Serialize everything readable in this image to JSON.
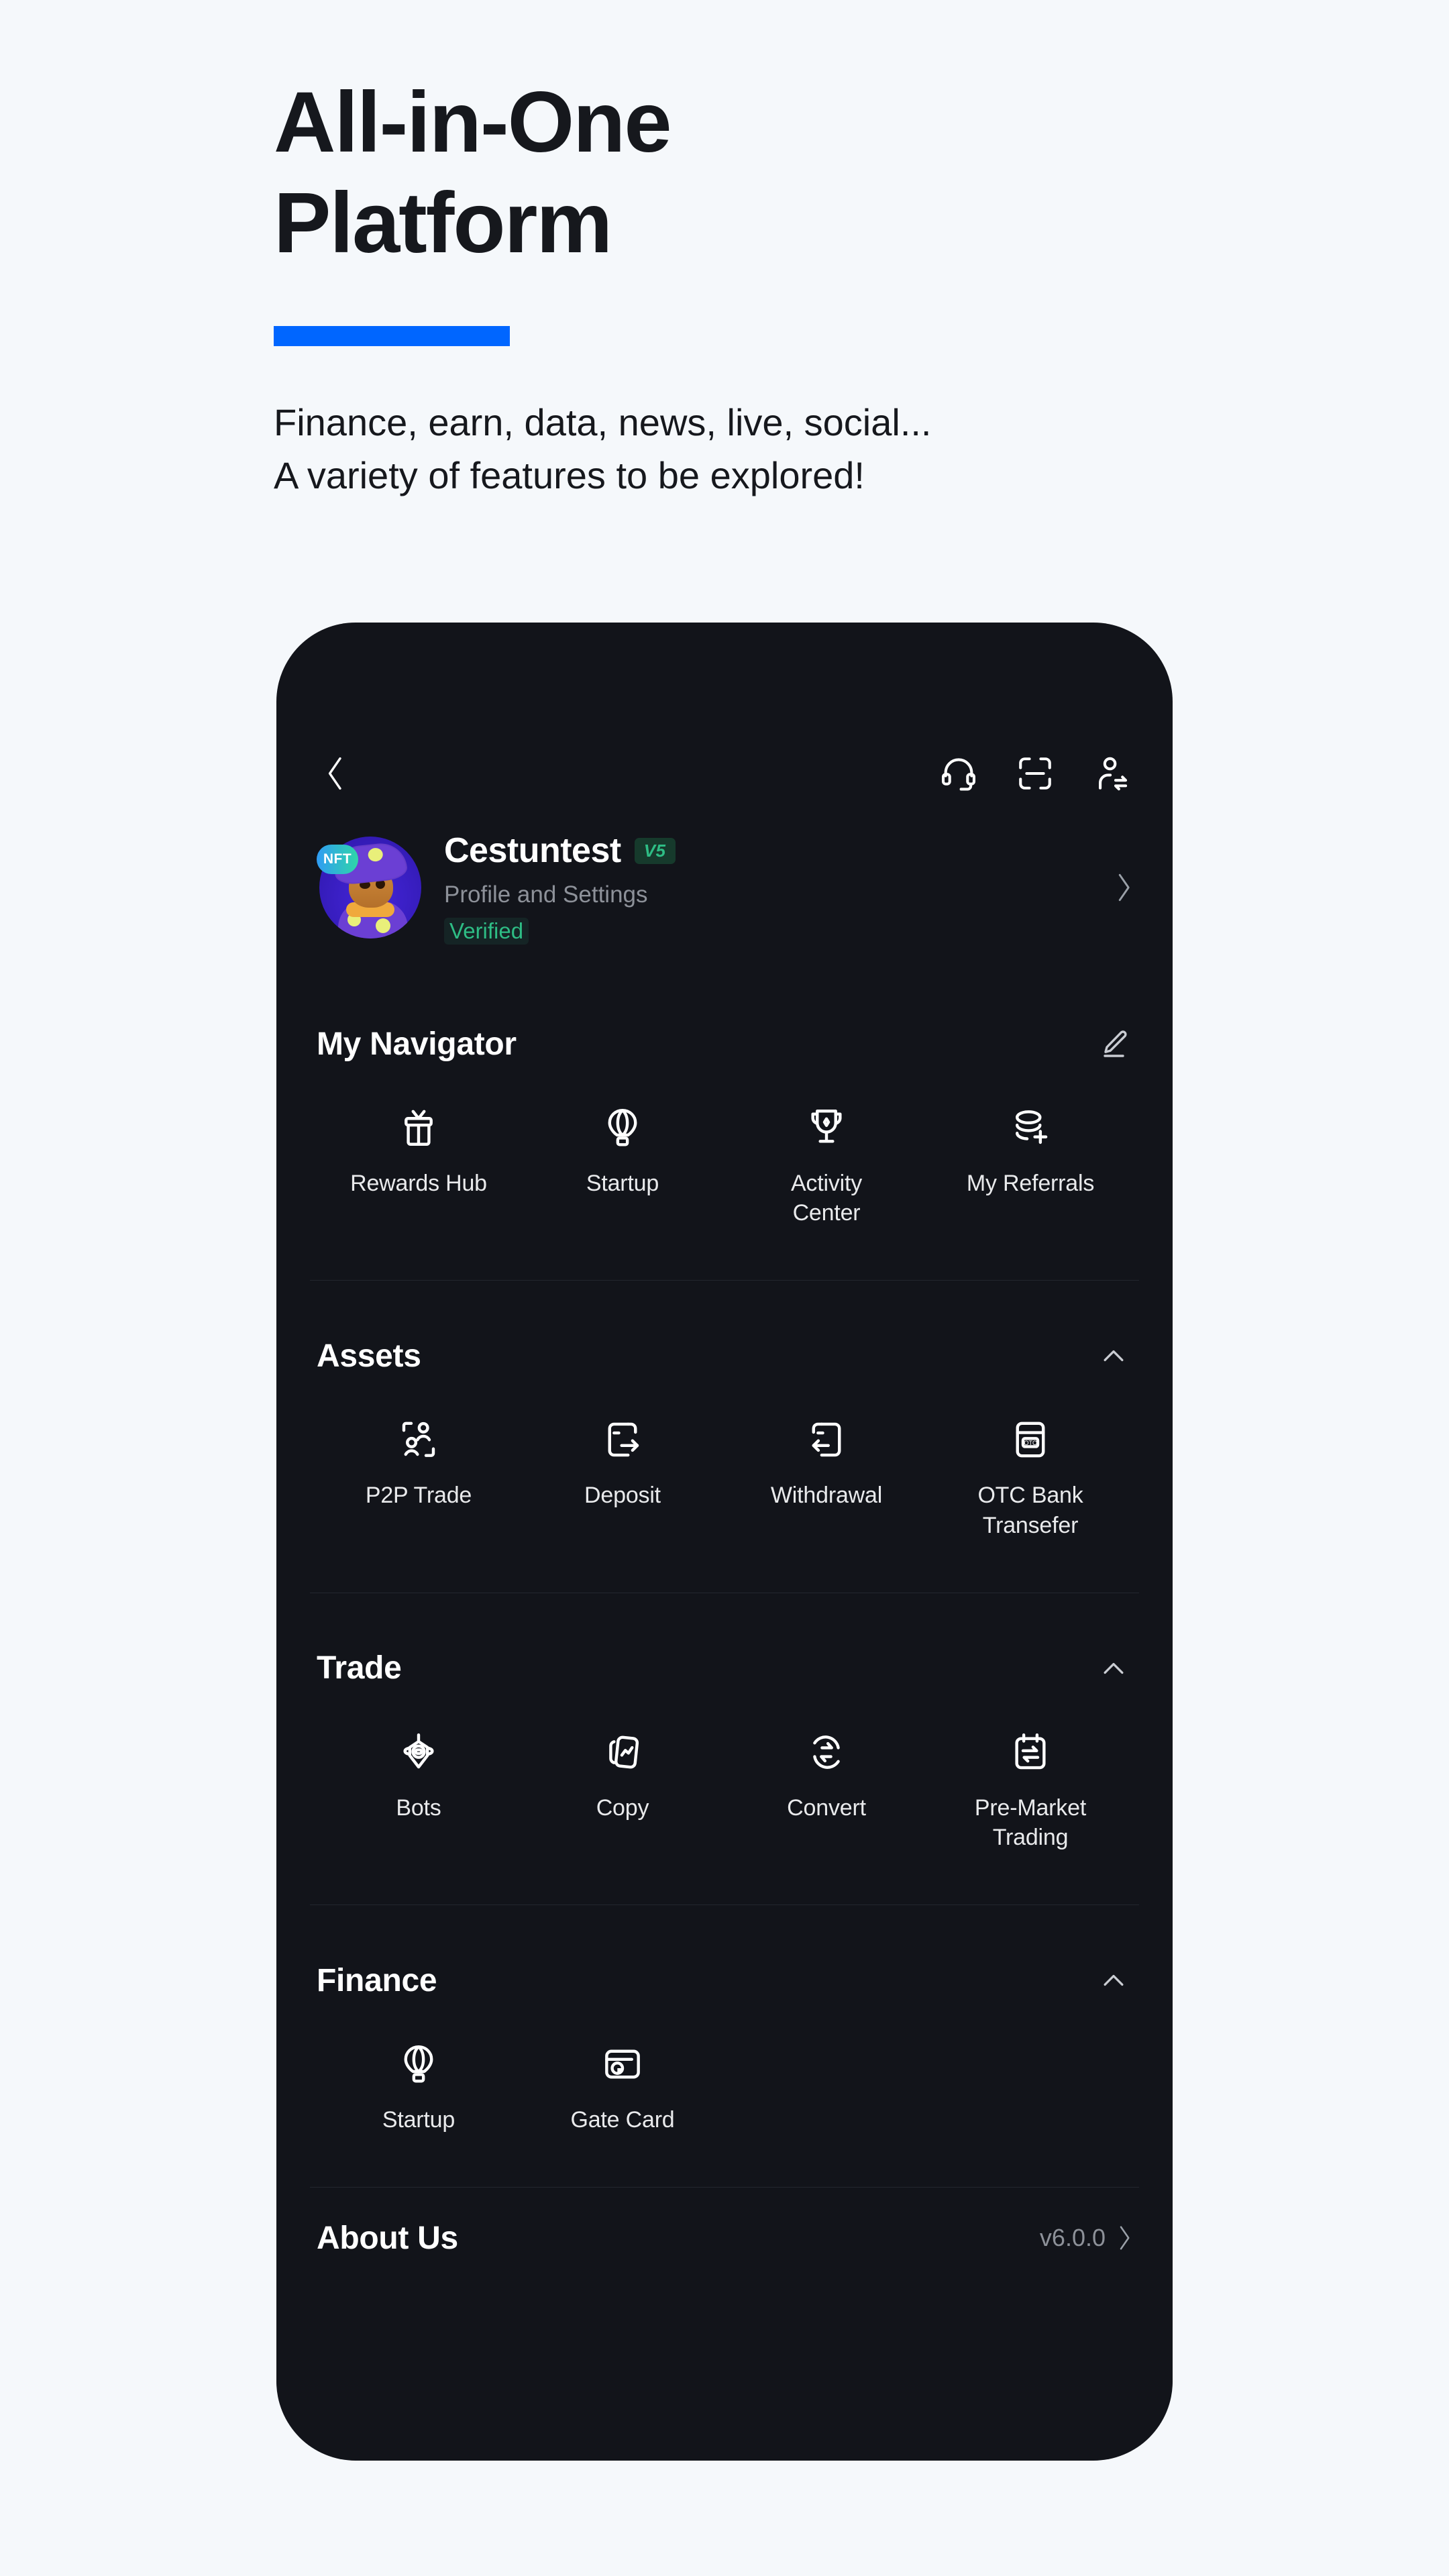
{
  "hero": {
    "title": "All-in-One\nPlatform",
    "accent_color": "#0066ff",
    "subtitle": "Finance, earn, data, news, live, social...\nA variety of features to be explored!"
  },
  "phone": {
    "topbar": {
      "back_icon": "chevron-left-icon",
      "icons": [
        {
          "name": "headset-support-icon"
        },
        {
          "name": "scan-qr-icon"
        },
        {
          "name": "switch-account-icon"
        }
      ]
    },
    "profile": {
      "avatar_badge": "NFT",
      "username": "Cestuntest",
      "level_badge": "V5",
      "level_badge_color": "#2ebd85",
      "subtitle": "Profile and Settings",
      "status": "Verified",
      "status_color": "#2ebd85",
      "chevron": "chevron-right-icon"
    },
    "sections": [
      {
        "title": "My Navigator",
        "action_icon": "edit-pencil-icon",
        "collapsible": false,
        "items": [
          {
            "label": "Rewards Hub",
            "icon": "gift-icon"
          },
          {
            "label": "Startup",
            "icon": "hot-air-balloon-icon"
          },
          {
            "label": "Activity\nCenter",
            "icon": "trophy-icon"
          },
          {
            "label": "My Referrals",
            "icon": "coin-stack-plus-icon"
          }
        ]
      },
      {
        "title": "Assets",
        "action_icon": "chevron-up-icon",
        "collapsible": true,
        "items": [
          {
            "label": "P2P Trade",
            "icon": "two-people-icon"
          },
          {
            "label": "Deposit",
            "icon": "card-arrow-right-icon"
          },
          {
            "label": "Withdrawal",
            "icon": "card-arrow-left-icon"
          },
          {
            "label": "OTC Bank\nTransefer",
            "icon": "otc-card-icon"
          }
        ]
      },
      {
        "title": "Trade",
        "action_icon": "chevron-up-icon",
        "collapsible": true,
        "items": [
          {
            "label": "Bots",
            "icon": "robot-icon"
          },
          {
            "label": "Copy",
            "icon": "copy-chart-icon"
          },
          {
            "label": "Convert",
            "icon": "convert-circle-icon"
          },
          {
            "label": "Pre-Market\nTrading",
            "icon": "calendar-swap-icon"
          }
        ]
      },
      {
        "title": "Finance",
        "action_icon": "chevron-up-icon",
        "collapsible": true,
        "items": [
          {
            "label": "Startup",
            "icon": "hot-air-balloon-icon"
          },
          {
            "label": "Gate Card",
            "icon": "gate-card-icon"
          }
        ]
      }
    ],
    "about": {
      "label": "About Us",
      "version": "v6.0.0",
      "chevron": "chevron-right-icon"
    }
  }
}
